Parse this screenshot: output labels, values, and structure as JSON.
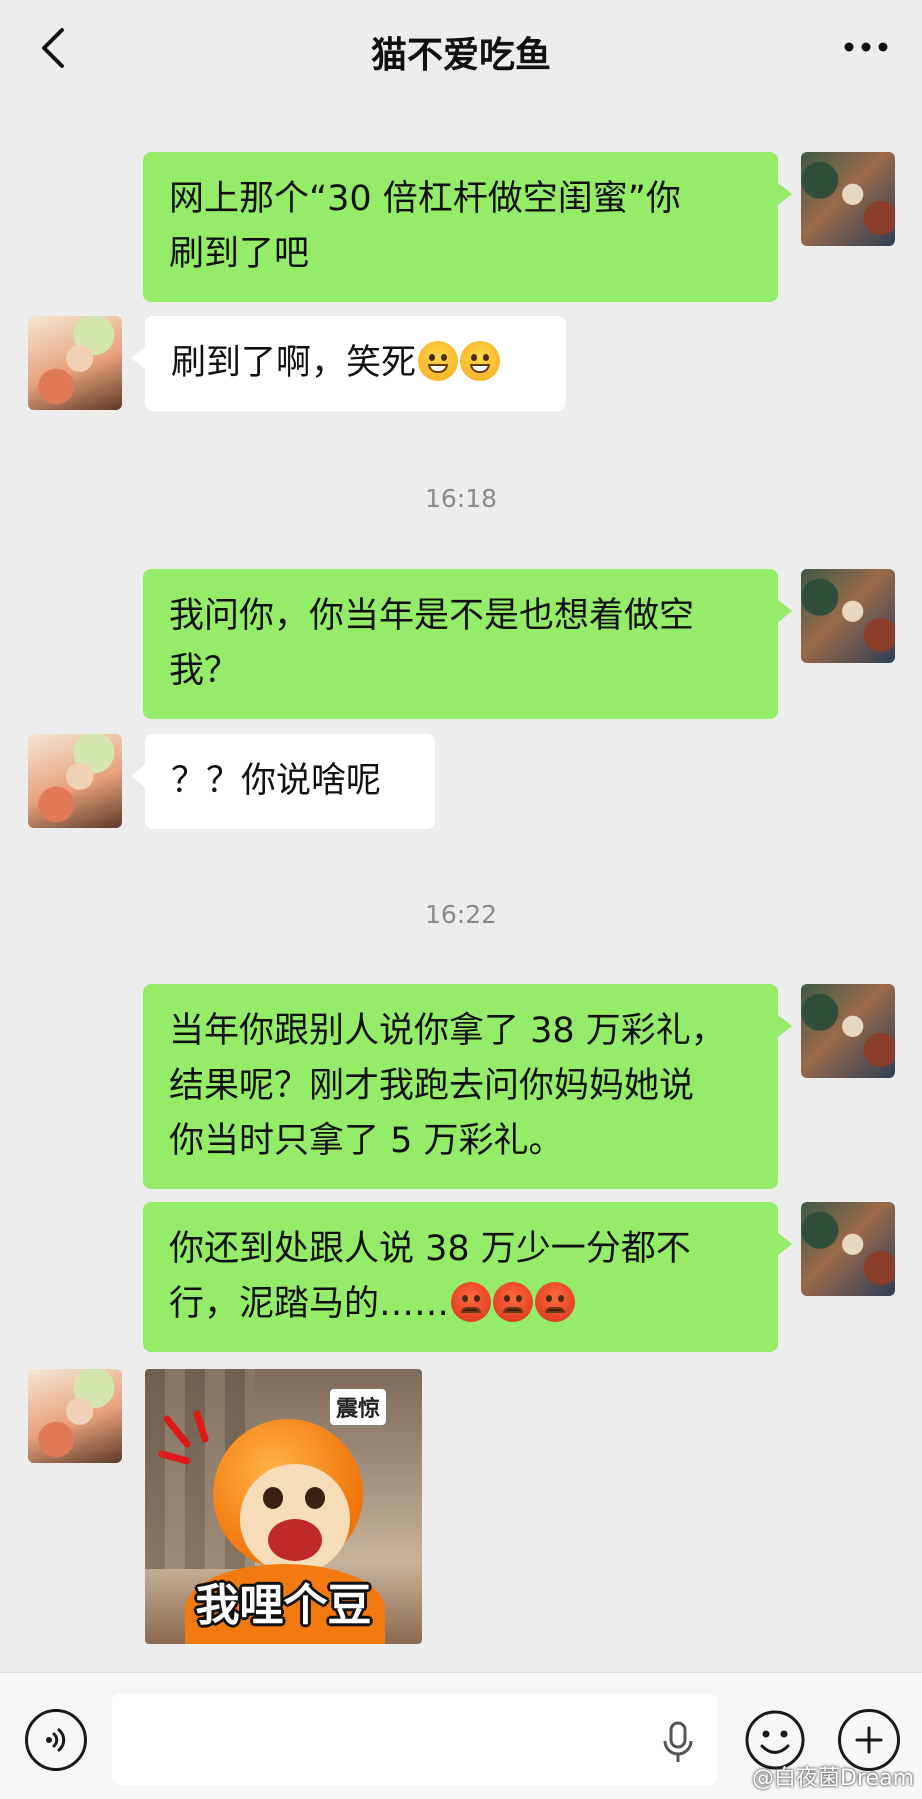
{
  "header": {
    "title": "猫不爱吃鱼",
    "back_icon": "chevron-left-icon",
    "more_icon": "more-dots-icon"
  },
  "messages": [
    {
      "side": "me",
      "text": "网上那个“30倍杠杆做空闺蜜”你刷到了吧"
    },
    {
      "side": "other",
      "text": "刷到了啊，笑死",
      "emoji": [
        "grin",
        "grin"
      ]
    },
    {
      "time": "16:18"
    },
    {
      "side": "me",
      "text": "我问你，你当年是不是也想着做空我？"
    },
    {
      "side": "other",
      "text": "？？你说啥呢"
    },
    {
      "time": "16:22"
    },
    {
      "side": "me",
      "text": "当年你跟别人说你拿了38万彩礼，结果呢？刚才我跑去问你妈妈她说你当时只拿了5万彩礼。"
    },
    {
      "side": "me",
      "text": "你还到处跟人说38万少一分都不行，泥踏马的……",
      "emoji": [
        "angry",
        "angry",
        "angry"
      ]
    },
    {
      "side": "other",
      "sticker": {
        "tag": "震惊",
        "caption": "我哩个豆"
      }
    }
  ],
  "bubbles": {
    "m1_l1": "网上那个“30 倍杠杆做空闺蜜”你",
    "m1_l2": "刷到了吧",
    "m2": "刷到了啊，笑死",
    "t1": "16:18",
    "m3_l1": "我问你，你当年是不是也想着做空",
    "m3_l2": "我？",
    "m4": "？？你说啥呢",
    "t2": "16:22",
    "m5_l1": "当年你跟别人说你拿了 38 万彩礼，",
    "m5_l2": "结果呢？刚才我跑去问你妈妈她说",
    "m5_l3": "你当时只拿了 5 万彩礼。",
    "m6_l1": "你还到处跟人说 38 万少一分都不",
    "m6_l2": "行，泥踏马的……",
    "sticker_tag": "震惊",
    "sticker_caption": "我哩个豆"
  },
  "input_bar": {
    "voice_icon": "voice-wave-icon",
    "input_value": "",
    "mic_icon": "microphone-icon",
    "emoji_icon": "smiley-icon",
    "plus_icon": "plus-icon"
  },
  "watermark": "@白夜菌Dream",
  "colors": {
    "background": "#ededed",
    "my_bubble": "#95ec69",
    "other_bubble": "#ffffff",
    "timestamp": "#8a8a8a"
  }
}
